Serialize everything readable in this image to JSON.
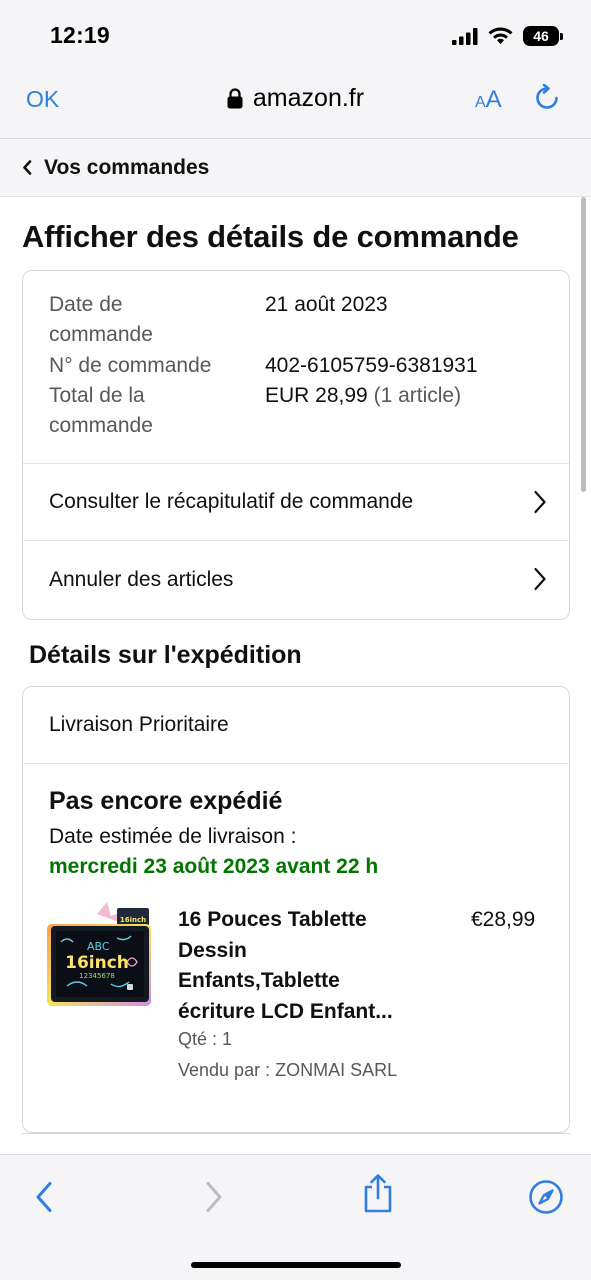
{
  "status_bar": {
    "time": "12:19",
    "battery": "46"
  },
  "browser": {
    "done_label": "OK",
    "url": "amazon.fr",
    "text_size_label_small": "A",
    "text_size_label_large": "A"
  },
  "breadcrumb": {
    "back_label": "Vos commandes"
  },
  "page": {
    "title": "Afficher des détails de commande"
  },
  "order_summary": {
    "date_label": "Date de commande",
    "date_value": "21 août 2023",
    "number_label": "N° de commande",
    "number_value": "402-6105759-6381931",
    "total_label": "Total de la commande",
    "total_value": "EUR 28,99",
    "total_items": "(1 article)"
  },
  "links": {
    "recap": "Consulter le récapitulatif de commande",
    "cancel": "Annuler des articles"
  },
  "shipping": {
    "section_title": "Détails sur l'expédition",
    "method": "Livraison Prioritaire",
    "status": "Pas encore expédié",
    "eta_label": "Date estimée de livraison :",
    "eta_date": "mercredi 23 août 2023 avant 22 h"
  },
  "product": {
    "title_line1": "16 Pouces Tablette",
    "title_line2": "Dessin",
    "title_line3": "Enfants,Tablette",
    "title_line4": "écriture LCD Enfant...",
    "price": "€28,99",
    "qty": "Qté : 1",
    "seller": "Vendu par : ZONMAI SARL",
    "thumb_text_top": "ABC",
    "thumb_text_main": "16inch",
    "thumb_text_digits": "12345678",
    "thumb_badge": "16inch"
  },
  "colors": {
    "ios_blue": "#2f7fe0",
    "delivery_green": "#007600",
    "text_primary": "#0f1111",
    "text_secondary": "#565959"
  },
  "icons": {
    "lock": "lock-icon",
    "reload": "reload-icon",
    "back": "chevron-left-icon",
    "row_chevron": "chevron-right-icon",
    "share": "share-icon",
    "compass": "compass-icon"
  }
}
